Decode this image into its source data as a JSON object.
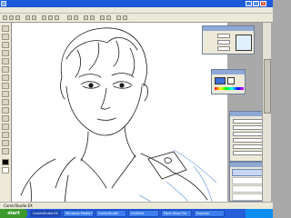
{
  "window": {
    "title": "",
    "minimize_icon": "minimize-icon",
    "maximize_icon": "maximize-icon",
    "close_icon": "close-icon"
  },
  "status": {
    "text": "ComicStudio EX"
  },
  "taskbar": {
    "start_label": "start",
    "items": [
      {
        "label": "ComicStudio EX"
      },
      {
        "label": "Windows Media Player"
      },
      {
        "label": "ComicStudio"
      },
      {
        "label": "Untitled"
      },
      {
        "label": "Paint Shop Pro"
      },
      {
        "label": "Explorer"
      }
    ],
    "clock": ""
  },
  "palettes": {
    "brush": {
      "swatch_color": "#dff0ff"
    },
    "color": {
      "swatch_color": "#3f6fd8",
      "swatch2_color": "#ffffff"
    },
    "layer": {}
  },
  "colors": {
    "titlebar": "#1d5ad9",
    "taskbar": "#245edb",
    "start_button": "#3c9a2b",
    "canvas": "#ffffff",
    "sketch_line": "#1a1a1a",
    "blue_line": "#6f9fe0"
  }
}
